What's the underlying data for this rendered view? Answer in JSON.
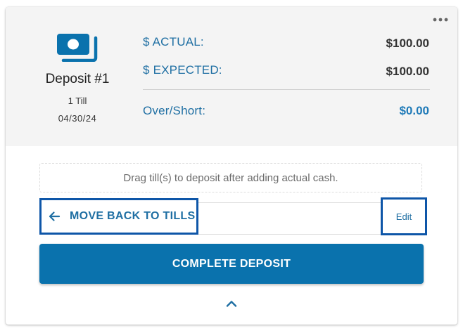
{
  "card": {
    "more_icon": "more-horizontal-icon",
    "deposit_icon": "cash-icon",
    "deposit_name": "Deposit #1",
    "till_count": "1 Till",
    "date": "04/30/24",
    "summary": {
      "actual_label": "$ ACTUAL:",
      "actual_value": "$100.00",
      "expected_label": "$ EXPECTED:",
      "expected_value": "$100.00",
      "overshort_label": "Over/Short:",
      "overshort_value": "$0.00"
    },
    "drop_zone_text": "Drag till(s) to deposit after adding actual cash.",
    "move_back_label": "MOVE BACK TO TILLS",
    "move_back_icon": "arrow-left-icon",
    "edit_label": "Edit",
    "complete_label": "COMPLETE DEPOSIT",
    "collapse_icon": "chevron-up-icon"
  },
  "colors": {
    "accent": "#1f6fa3",
    "button": "#0a72ad",
    "highlight_border": "#0e56a8",
    "panel_bg": "#f4f4f4"
  }
}
